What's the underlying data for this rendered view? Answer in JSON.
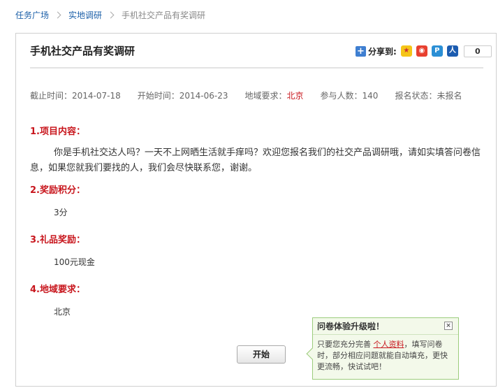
{
  "breadcrumb": {
    "items": [
      "任务广场",
      "实地调研",
      "手机社交产品有奖调研"
    ]
  },
  "survey": {
    "title": "手机社交产品有奖调研"
  },
  "share": {
    "label": "分享到:",
    "count": "0",
    "icons": [
      "qzone-icon",
      "weibo-icon",
      "tencent-weibo-icon",
      "renren-icon"
    ]
  },
  "meta": {
    "deadline": "截止时间：2014-07-18",
    "start": "开始时间：2014-06-23",
    "region_label": "地域要求：",
    "region_value": "北京",
    "participants": "参与人数：140",
    "status": "报名状态：未报名"
  },
  "sections": {
    "content": {
      "heading": "1.项目内容：",
      "body": "你是手机社交达人吗？一天不上网晒生活就手痒吗？欢迎您报名我们的社交产品调研哦，请如实填答问卷信息，如果您就我们要找的人，我们会尽快联系您，谢谢。"
    },
    "points": {
      "heading": "2.奖励积分：",
      "body": "3分"
    },
    "gift": {
      "heading": "3.礼品奖励：",
      "body": "100元现金"
    },
    "region": {
      "heading": "4.地域要求：",
      "body": "北京"
    }
  },
  "actions": {
    "start_label": "开始"
  },
  "popup": {
    "title": "问卷体验升级啦！",
    "close": "×",
    "text_before": "只要您充分完善",
    "link": "个人资料",
    "text_after": "，填写问卷时，部分相应问题就能自动填充，更快更流畅，快试试吧！"
  },
  "colors": {
    "accent_red": "#c8161d",
    "link_blue": "#1b5fa8",
    "popup_bg": "#f3f9ea"
  }
}
